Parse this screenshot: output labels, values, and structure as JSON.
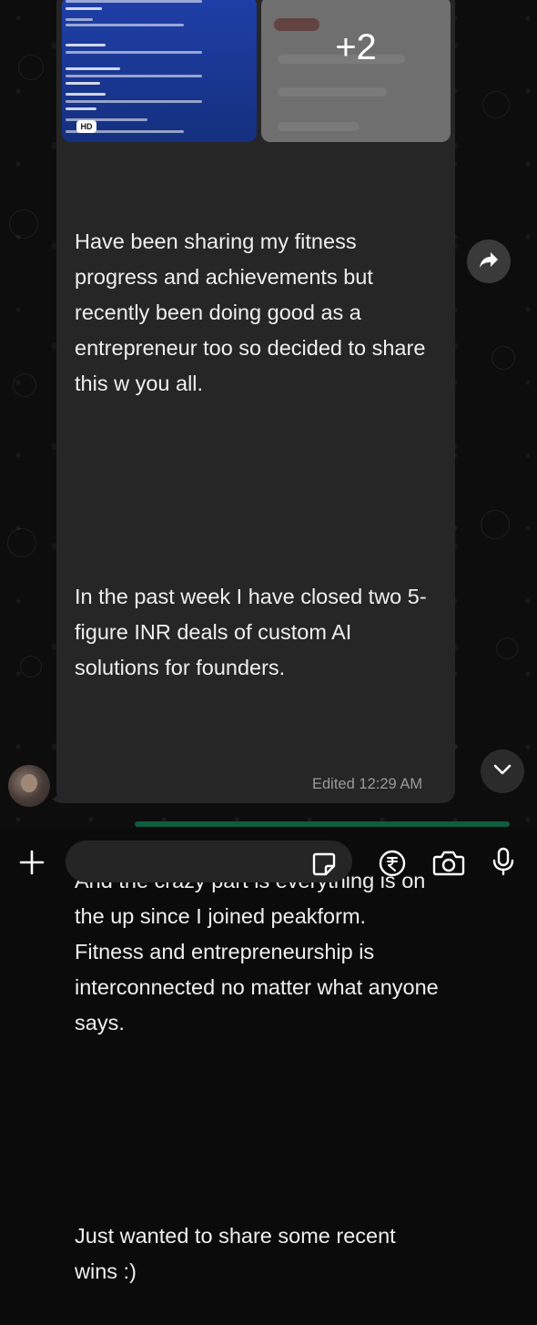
{
  "message": {
    "attachments": {
      "hd_badge": "HD",
      "more_count": "+2"
    },
    "paragraphs": [
      "Have been sharing my fitness progress and achievements but recently been doing good as a entrepreneur too so decided to share this w you all.",
      "In the past week I have closed two 5-figure INR deals of custom AI solutions for founders.",
      "And the crazy part is everything is on the up since I joined peakform. Fitness and entrepreneurship is interconnected no matter what anyone says.",
      "Just wanted to share some recent wins :)"
    ],
    "edited_label": "Edited",
    "time": "12:29 AM"
  },
  "composer": {
    "plus_icon": "plus-icon",
    "sticker_icon": "sticker-icon",
    "payment_icon": "rupee-icon",
    "camera_icon": "camera-icon",
    "mic_icon": "microphone-icon"
  },
  "colors": {
    "bubble": "#262626",
    "text": "#efefef",
    "meta": "#9a9a9a",
    "background": "#0d0d0d",
    "accent_green": "#0f5c3f"
  }
}
